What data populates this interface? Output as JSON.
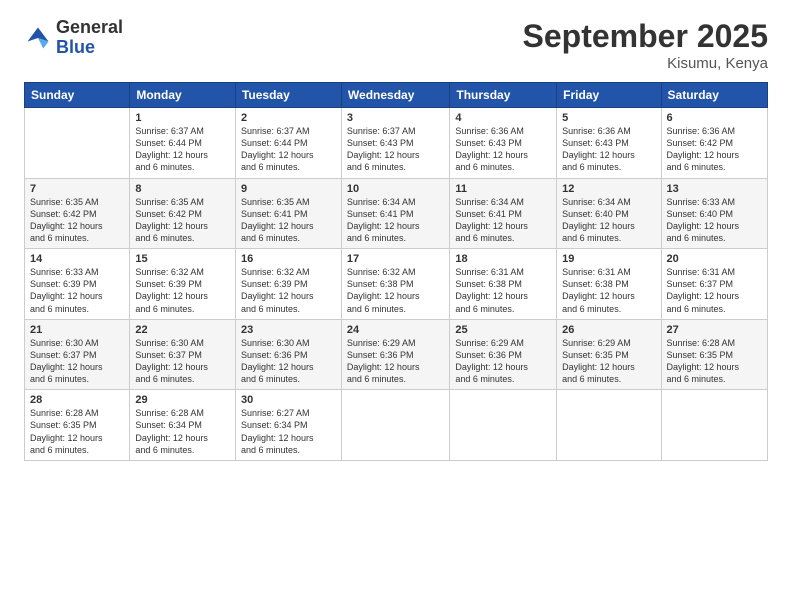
{
  "header": {
    "logo_general": "General",
    "logo_blue": "Blue",
    "month_title": "September 2025",
    "location": "Kisumu, Kenya"
  },
  "days_of_week": [
    "Sunday",
    "Monday",
    "Tuesday",
    "Wednesday",
    "Thursday",
    "Friday",
    "Saturday"
  ],
  "weeks": [
    [
      {
        "day": "",
        "info": ""
      },
      {
        "day": "1",
        "info": "Sunrise: 6:37 AM\nSunset: 6:44 PM\nDaylight: 12 hours\nand 6 minutes."
      },
      {
        "day": "2",
        "info": "Sunrise: 6:37 AM\nSunset: 6:44 PM\nDaylight: 12 hours\nand 6 minutes."
      },
      {
        "day": "3",
        "info": "Sunrise: 6:37 AM\nSunset: 6:43 PM\nDaylight: 12 hours\nand 6 minutes."
      },
      {
        "day": "4",
        "info": "Sunrise: 6:36 AM\nSunset: 6:43 PM\nDaylight: 12 hours\nand 6 minutes."
      },
      {
        "day": "5",
        "info": "Sunrise: 6:36 AM\nSunset: 6:43 PM\nDaylight: 12 hours\nand 6 minutes."
      },
      {
        "day": "6",
        "info": "Sunrise: 6:36 AM\nSunset: 6:42 PM\nDaylight: 12 hours\nand 6 minutes."
      }
    ],
    [
      {
        "day": "7",
        "info": "Sunrise: 6:35 AM\nSunset: 6:42 PM\nDaylight: 12 hours\nand 6 minutes."
      },
      {
        "day": "8",
        "info": "Sunrise: 6:35 AM\nSunset: 6:42 PM\nDaylight: 12 hours\nand 6 minutes."
      },
      {
        "day": "9",
        "info": "Sunrise: 6:35 AM\nSunset: 6:41 PM\nDaylight: 12 hours\nand 6 minutes."
      },
      {
        "day": "10",
        "info": "Sunrise: 6:34 AM\nSunset: 6:41 PM\nDaylight: 12 hours\nand 6 minutes."
      },
      {
        "day": "11",
        "info": "Sunrise: 6:34 AM\nSunset: 6:41 PM\nDaylight: 12 hours\nand 6 minutes."
      },
      {
        "day": "12",
        "info": "Sunrise: 6:34 AM\nSunset: 6:40 PM\nDaylight: 12 hours\nand 6 minutes."
      },
      {
        "day": "13",
        "info": "Sunrise: 6:33 AM\nSunset: 6:40 PM\nDaylight: 12 hours\nand 6 minutes."
      }
    ],
    [
      {
        "day": "14",
        "info": "Sunrise: 6:33 AM\nSunset: 6:39 PM\nDaylight: 12 hours\nand 6 minutes."
      },
      {
        "day": "15",
        "info": "Sunrise: 6:32 AM\nSunset: 6:39 PM\nDaylight: 12 hours\nand 6 minutes."
      },
      {
        "day": "16",
        "info": "Sunrise: 6:32 AM\nSunset: 6:39 PM\nDaylight: 12 hours\nand 6 minutes."
      },
      {
        "day": "17",
        "info": "Sunrise: 6:32 AM\nSunset: 6:38 PM\nDaylight: 12 hours\nand 6 minutes."
      },
      {
        "day": "18",
        "info": "Sunrise: 6:31 AM\nSunset: 6:38 PM\nDaylight: 12 hours\nand 6 minutes."
      },
      {
        "day": "19",
        "info": "Sunrise: 6:31 AM\nSunset: 6:38 PM\nDaylight: 12 hours\nand 6 minutes."
      },
      {
        "day": "20",
        "info": "Sunrise: 6:31 AM\nSunset: 6:37 PM\nDaylight: 12 hours\nand 6 minutes."
      }
    ],
    [
      {
        "day": "21",
        "info": "Sunrise: 6:30 AM\nSunset: 6:37 PM\nDaylight: 12 hours\nand 6 minutes."
      },
      {
        "day": "22",
        "info": "Sunrise: 6:30 AM\nSunset: 6:37 PM\nDaylight: 12 hours\nand 6 minutes."
      },
      {
        "day": "23",
        "info": "Sunrise: 6:30 AM\nSunset: 6:36 PM\nDaylight: 12 hours\nand 6 minutes."
      },
      {
        "day": "24",
        "info": "Sunrise: 6:29 AM\nSunset: 6:36 PM\nDaylight: 12 hours\nand 6 minutes."
      },
      {
        "day": "25",
        "info": "Sunrise: 6:29 AM\nSunset: 6:36 PM\nDaylight: 12 hours\nand 6 minutes."
      },
      {
        "day": "26",
        "info": "Sunrise: 6:29 AM\nSunset: 6:35 PM\nDaylight: 12 hours\nand 6 minutes."
      },
      {
        "day": "27",
        "info": "Sunrise: 6:28 AM\nSunset: 6:35 PM\nDaylight: 12 hours\nand 6 minutes."
      }
    ],
    [
      {
        "day": "28",
        "info": "Sunrise: 6:28 AM\nSunset: 6:35 PM\nDaylight: 12 hours\nand 6 minutes."
      },
      {
        "day": "29",
        "info": "Sunrise: 6:28 AM\nSunset: 6:34 PM\nDaylight: 12 hours\nand 6 minutes."
      },
      {
        "day": "30",
        "info": "Sunrise: 6:27 AM\nSunset: 6:34 PM\nDaylight: 12 hours\nand 6 minutes."
      },
      {
        "day": "",
        "info": ""
      },
      {
        "day": "",
        "info": ""
      },
      {
        "day": "",
        "info": ""
      },
      {
        "day": "",
        "info": ""
      }
    ]
  ]
}
